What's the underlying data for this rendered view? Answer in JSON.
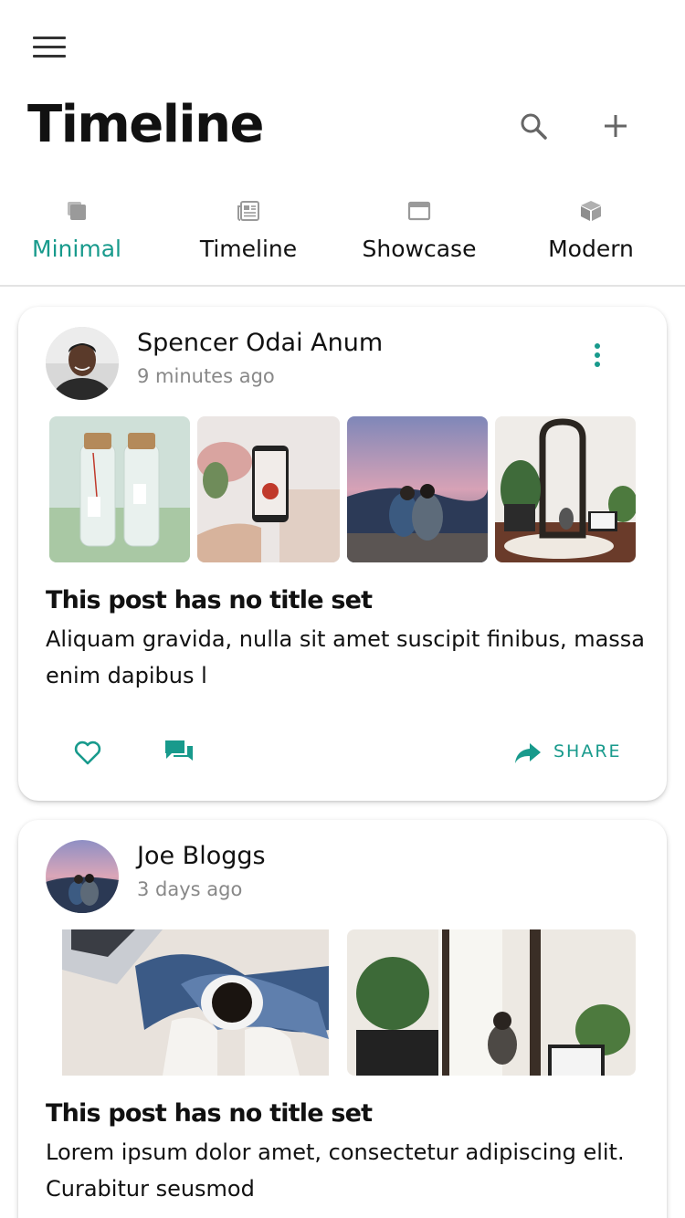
{
  "header": {
    "title": "Timeline",
    "menu_icon": "hamburger-menu-icon",
    "search_icon": "search-icon",
    "add_icon": "plus-icon"
  },
  "tabs": [
    {
      "label": "Minimal",
      "icon": "copy-icon",
      "active": true
    },
    {
      "label": "Timeline",
      "icon": "newspaper-icon",
      "active": false
    },
    {
      "label": "Showcase",
      "icon": "window-icon",
      "active": false
    },
    {
      "label": "Modern",
      "icon": "cube-icon",
      "active": false
    }
  ],
  "posts": [
    {
      "author": "Spencer Odai Anum",
      "time": "9 minutes ago",
      "title": "This post has no title set",
      "body": "Aliquam gravida, nulla sit amet suscipit finibus, massa enim dapibus l",
      "share_label": "SHARE"
    },
    {
      "author": "Joe Bloggs",
      "time": "3 days ago",
      "title": "This post has no title set",
      "body": "Lorem ipsum dolor amet, consectetur adipiscing elit. Curabitur seusmod"
    }
  ],
  "colors": {
    "accent": "#189a8c",
    "text": "#111111",
    "muted": "#888888",
    "divider": "#e3e3e3"
  }
}
